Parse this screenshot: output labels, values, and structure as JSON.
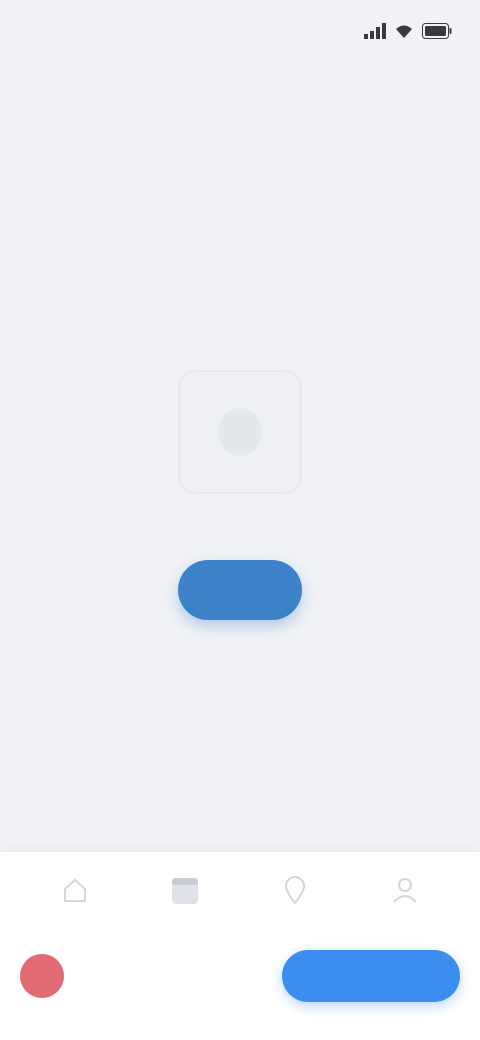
{
  "status_bar": {
    "time": "",
    "icons": [
      "signal-icon",
      "wifi-icon",
      "battery-icon"
    ]
  },
  "page": {
    "title": ""
  },
  "empty_state": {
    "illustration_icon": "empty-box-icon",
    "message": "",
    "button_label": ""
  },
  "bottom_nav": {
    "items": [
      {
        "icon": "home-icon"
      },
      {
        "icon": "calendar-icon"
      },
      {
        "icon": "location-icon"
      },
      {
        "icon": "profile-icon"
      }
    ]
  },
  "bottom_bar": {
    "user_label": "",
    "cta_label": ""
  },
  "colors": {
    "background": "#f0f2f6",
    "primary": "#3d82c8",
    "cta": "#3b8def",
    "avatar": "#e06b73"
  }
}
